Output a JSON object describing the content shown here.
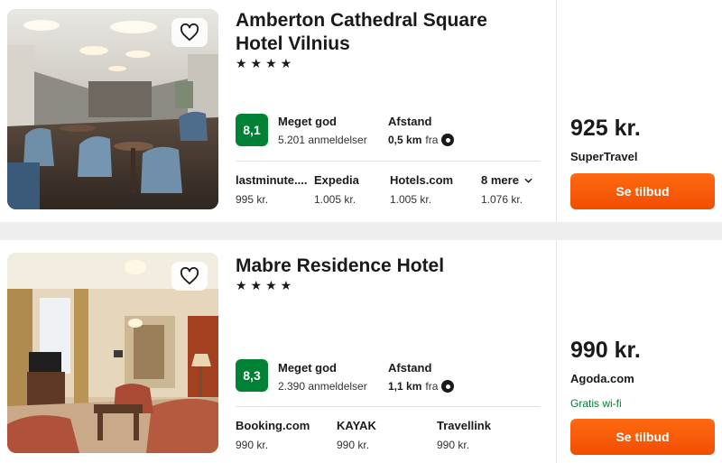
{
  "colors": {
    "rating_badge": "#008234",
    "cta": "#f55000",
    "perk_text": "#008234"
  },
  "results": [
    {
      "name": "Amberton Cathedral Square Hotel Vilnius",
      "stars": "★★★★",
      "score": "8,1",
      "rating_label": "Meget god",
      "reviews": "5.201 anmeldelser",
      "distance_label": "Afstand",
      "distance_value": "0,5 km",
      "distance_suffix": "fra",
      "providers": [
        {
          "name": "lastminute....",
          "price": "995 kr."
        },
        {
          "name": "Expedia",
          "price": "1.005 kr."
        },
        {
          "name": "Hotels.com",
          "price": "1.005 kr."
        },
        {
          "name": "8 mere",
          "price": "1.076 kr."
        }
      ],
      "best_price": "925 kr.",
      "best_site": "SuperTravel",
      "cta": "Se tilbud",
      "favorite_icon": "heart-icon"
    },
    {
      "name": "Mabre Residence Hotel",
      "stars": "★★★★",
      "score": "8,3",
      "rating_label": "Meget god",
      "reviews": "2.390 anmeldelser",
      "distance_label": "Afstand",
      "distance_value": "1,1 km",
      "distance_suffix": "fra",
      "providers": [
        {
          "name": "Booking.com",
          "price": "990 kr."
        },
        {
          "name": "KAYAK",
          "price": "990 kr."
        },
        {
          "name": "Travellink",
          "price": "990 kr."
        }
      ],
      "best_price": "990 kr.",
      "best_site": "Agoda.com",
      "perk": "Gratis wi-fi",
      "cta": "Se tilbud",
      "favorite_icon": "heart-icon"
    }
  ]
}
